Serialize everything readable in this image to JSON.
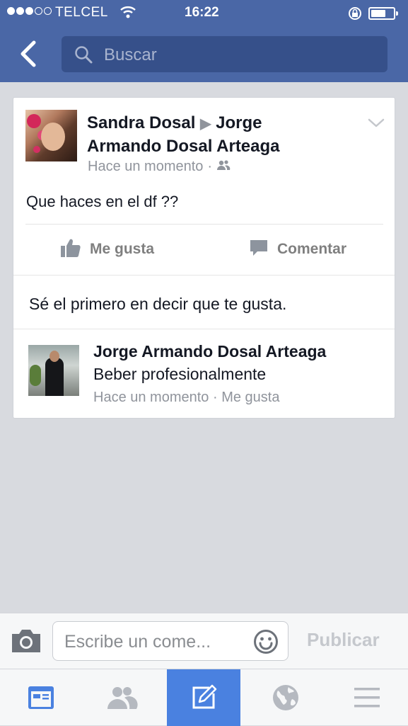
{
  "status_bar": {
    "carrier": "TELCEL",
    "time": "16:22",
    "signal_bars_filled": 3,
    "signal_bars_total": 5,
    "battery_level": 0.65
  },
  "search": {
    "placeholder": "Buscar"
  },
  "post": {
    "author": "Sandra Dosal",
    "target": "Jorge Armando Dosal Arteaga",
    "arrow": "▶",
    "time": "Hace un momento",
    "meta_separator": "·",
    "audience_icon": "friends-icon",
    "text": "Que haces en el df ??",
    "like_label": "Me gusta",
    "comment_label": "Comentar",
    "likes_prompt": "Sé el primero en decir que te gusta."
  },
  "comment": {
    "author": "Jorge Armando Dosal Arteaga",
    "text": "Beber profesionalmente",
    "time": "Hace un momento",
    "separator": "·",
    "like_label": "Me gusta"
  },
  "composer": {
    "placeholder": "Escribe un come...",
    "publish_label": "Publicar"
  },
  "tabbar": {
    "tabs": [
      {
        "icon": "news-feed-icon",
        "active": false
      },
      {
        "icon": "friends-icon",
        "active": false
      },
      {
        "icon": "compose-icon",
        "active": true
      },
      {
        "icon": "globe-icon",
        "active": false
      },
      {
        "icon": "menu-icon",
        "active": false
      }
    ]
  },
  "colors": {
    "header": "#4a67a6",
    "search_bg": "#36508a",
    "active_tab": "#4a81e0",
    "meta_text": "#90949c",
    "icon_gray": "#8d949e"
  }
}
